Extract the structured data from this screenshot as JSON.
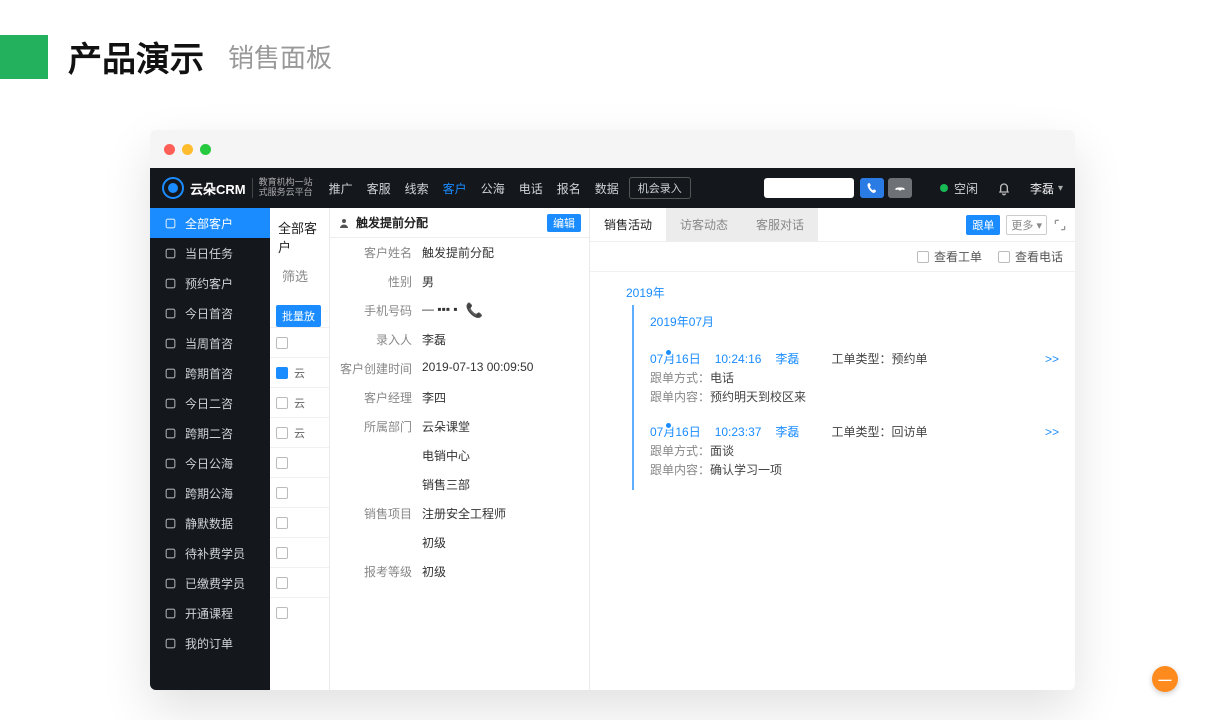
{
  "page": {
    "title_main": "产品演示",
    "title_sub": "销售面板"
  },
  "brand": {
    "name": "云朵CRM",
    "sub1": "教育机构一站",
    "sub2": "式服务云平台"
  },
  "topnav": {
    "items": [
      "推广",
      "客服",
      "线索",
      "客户",
      "公海",
      "电话",
      "报名",
      "数据"
    ],
    "active_index": 3,
    "opportunity_entry": "机会录入",
    "status_label": "空闲",
    "username": "李磊"
  },
  "sidebar": {
    "items": [
      "全部客户",
      "当日任务",
      "预约客户",
      "今日首咨",
      "当周首咨",
      "跨期首咨",
      "今日二咨",
      "跨期二咨",
      "今日公海",
      "跨期公海",
      "静默数据",
      "待补费学员",
      "已缴费学员",
      "开通课程",
      "我的订单"
    ],
    "active_index": 0
  },
  "listcol": {
    "header": "全部客户",
    "filter_label": "筛选",
    "batch_label": "批量放",
    "rows": [
      "",
      "云",
      "云",
      "云",
      "",
      "",
      "",
      "",
      "",
      ""
    ]
  },
  "detail": {
    "header_title": "触发提前分配",
    "edit_label": "编辑",
    "fields": [
      {
        "label": "客户姓名",
        "value": "触发提前分配"
      },
      {
        "label": "性别",
        "value": "男"
      },
      {
        "label": "手机号码",
        "value": "— ▪▪▪ ▪",
        "phone": true
      },
      {
        "label": "录入人",
        "value": "李磊"
      },
      {
        "label": "客户创建时间",
        "value": "2019-07-13 00:09:50"
      },
      {
        "label": "客户经理",
        "value": "李四"
      },
      {
        "label": "所属部门",
        "value": "云朵课堂"
      },
      {
        "label": "",
        "value": "电销中心"
      },
      {
        "label": "",
        "value": "销售三部"
      },
      {
        "label": "销售项目",
        "value": "注册安全工程师"
      },
      {
        "label": "",
        "value": "初级"
      },
      {
        "label": "报考等级",
        "value": "初级"
      }
    ]
  },
  "activity": {
    "tabs": [
      "销售活动",
      "访客动态",
      "客服对话"
    ],
    "active_tab": 0,
    "tag_follow": "跟单",
    "more_label": "更多",
    "filters": {
      "view_ticket": "查看工单",
      "view_call": "查看电话"
    },
    "year_label": "2019年",
    "month_label": "2019年07月",
    "events": [
      {
        "date": "07月16日",
        "time": "10:24:16",
        "user": "李磊",
        "type_label": "工单类型：",
        "type_value": "预约单",
        "method_label": "跟单方式：",
        "method_value": "电话",
        "content_label": "跟单内容：",
        "content_value": "预约明天到校区来",
        "more": ">>"
      },
      {
        "date": "07月16日",
        "time": "10:23:37",
        "user": "李磊",
        "type_label": "工单类型：",
        "type_value": "回访单",
        "method_label": "跟单方式：",
        "method_value": "面谈",
        "content_label": "跟单内容：",
        "content_value": "确认学习一项",
        "more": ">>"
      }
    ]
  },
  "colors": {
    "accent": "#1a8cff",
    "green": "#23b15e",
    "orange": "#ff8a1e"
  }
}
